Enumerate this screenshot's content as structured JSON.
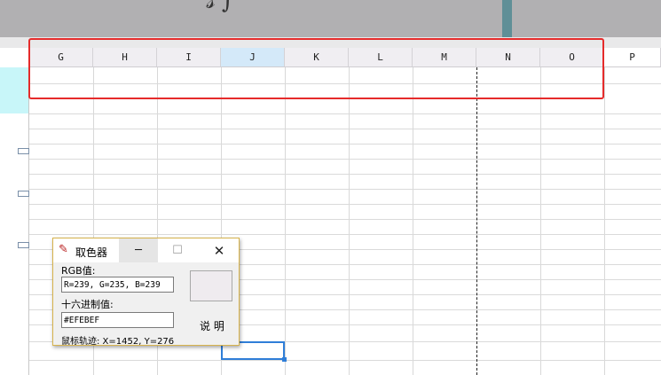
{
  "columns": [
    "G",
    "H",
    "I",
    "J",
    "K",
    "L",
    "M",
    "N",
    "O",
    "P"
  ],
  "selected_column": "J",
  "colors": {
    "highlight_box": "#e52b2b",
    "selected_cell": "#2f7ed8",
    "selected_row_header": "#c8f6f9",
    "selected_column_header": "#d4e9f9",
    "picked_color": "#EFEBEF"
  },
  "color_picker": {
    "title": "取色器",
    "rgb_label": "RGB值:",
    "rgb_value": "R=239, G=235, B=239",
    "hex_label": "十六进制值:",
    "hex_value": "#EFEBEF",
    "help_label": "说 明",
    "mouse_position": "鼠标轨迹: X=1452, Y=276",
    "minimize_icon": "minimize-icon",
    "maximize_icon": "maximize-icon",
    "close_icon": "close-icon",
    "app_icon": "pen-icon"
  }
}
